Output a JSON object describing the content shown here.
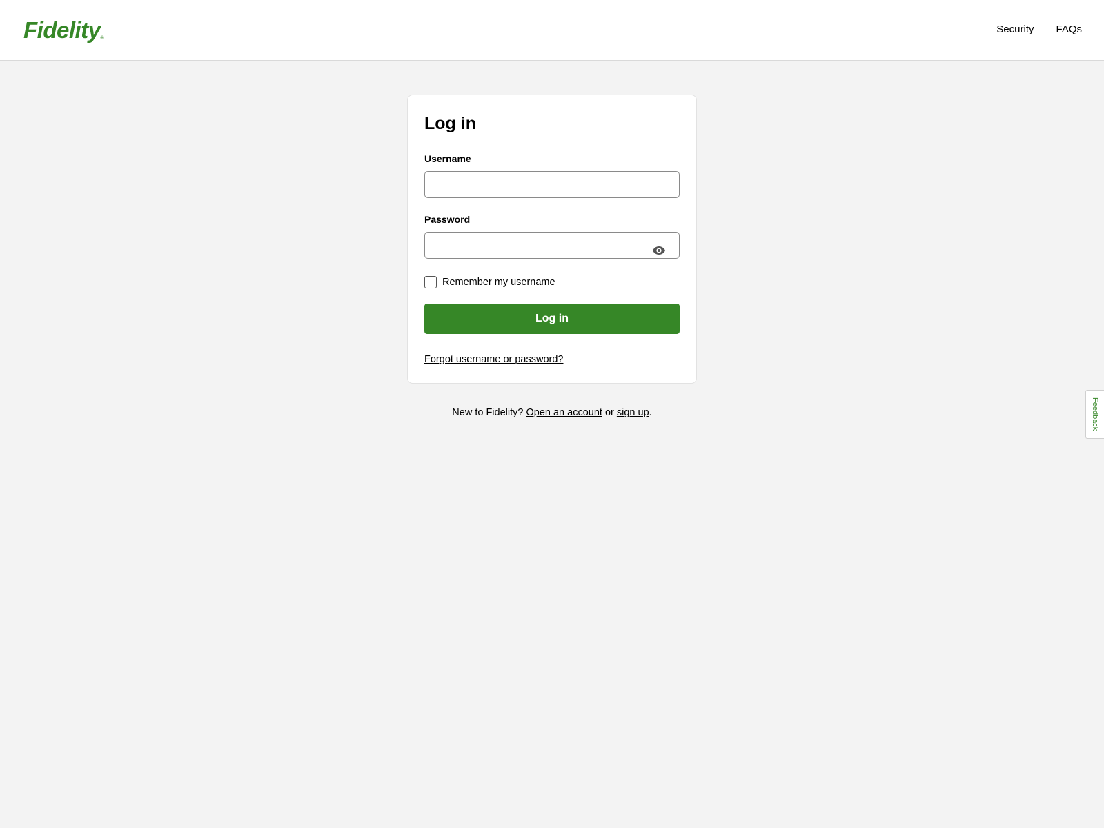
{
  "brand": {
    "logo_text": "Fidelity",
    "logo_mark": "®",
    "accent_color": "#368727"
  },
  "header": {
    "nav": [
      {
        "label": "Security"
      },
      {
        "label": "FAQs"
      }
    ]
  },
  "login": {
    "title": "Log in",
    "username": {
      "label": "Username",
      "value": "",
      "placeholder": ""
    },
    "password": {
      "label": "Password",
      "value": "",
      "placeholder": "",
      "toggle_icon": "eye-icon"
    },
    "remember": {
      "label": "Remember my username",
      "checked": false
    },
    "submit_label": "Log in",
    "forgot_label": "Forgot username or password?"
  },
  "signup": {
    "prefix": "New to Fidelity? ",
    "open_account_label": "Open an account",
    "or_text": " or ",
    "sign_up_label": "sign up",
    "suffix": "."
  },
  "feedback": {
    "label": "Feedback"
  }
}
